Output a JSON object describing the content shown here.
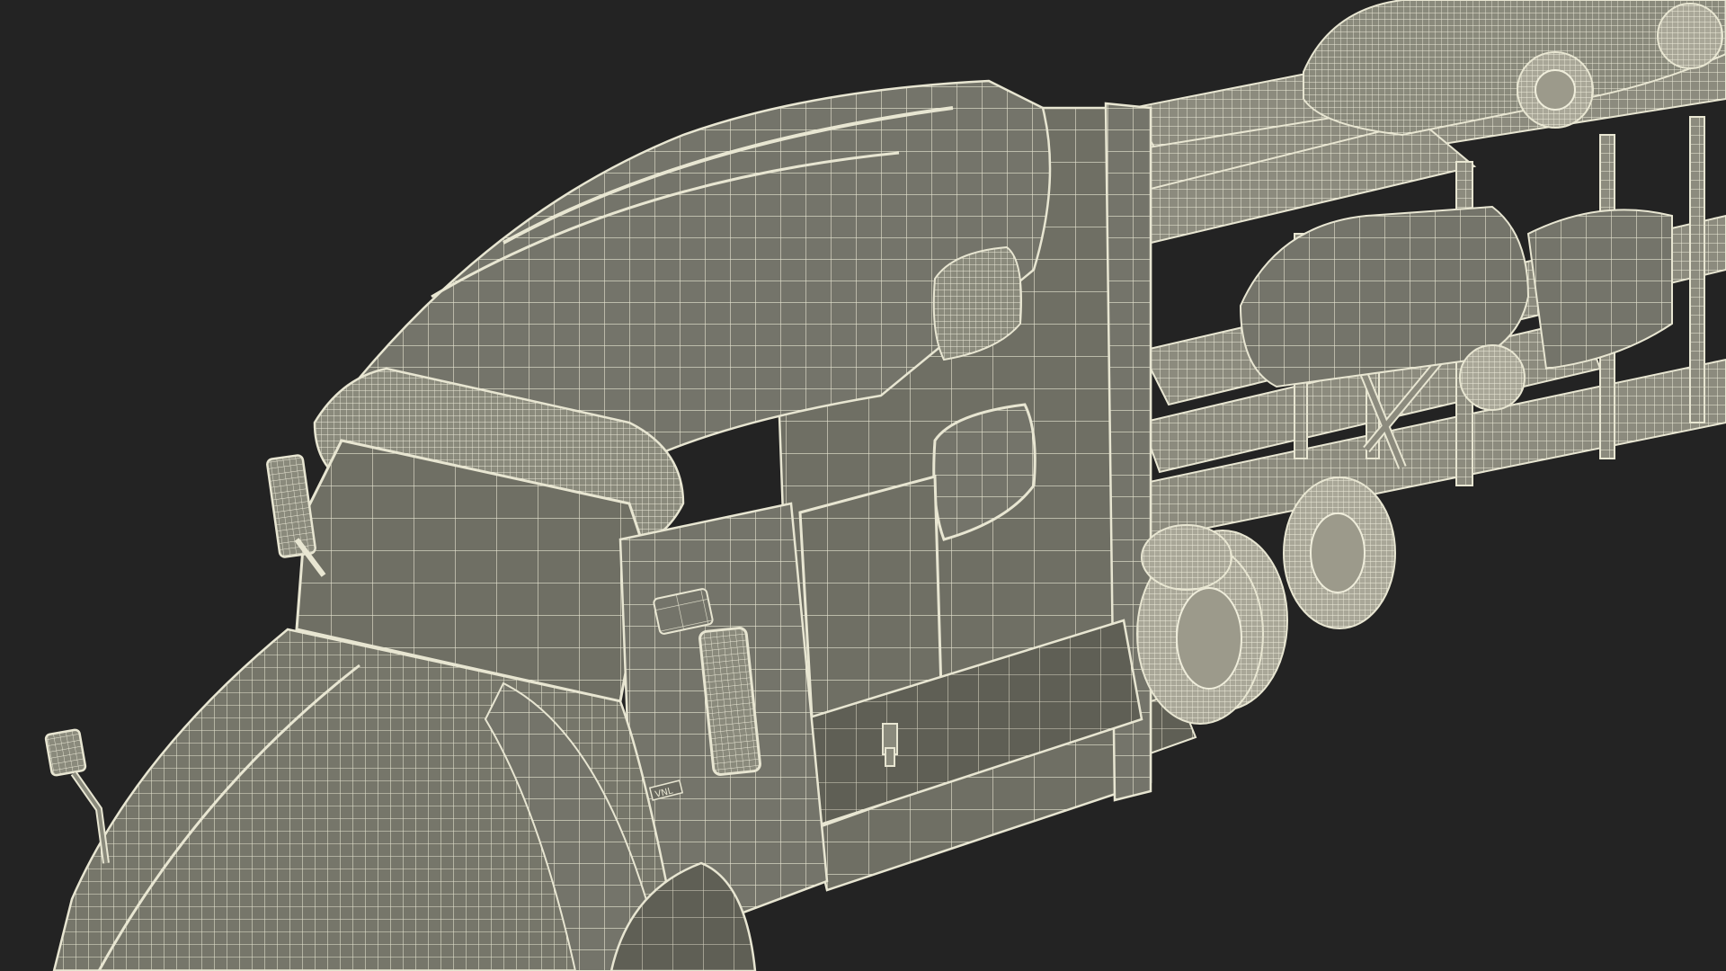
{
  "scene": {
    "subject": "semi-truck-car-carrier-wireframe",
    "render_style": "wireframe-shaded",
    "background_color": "#232323",
    "mesh_fill_color": "#76766a",
    "mesh_fill_dark": "#5f5f55",
    "mesh_fill_light": "#8a8a7c",
    "wire_color": "#e8e6d2",
    "tire_color": "#b8b6a6",
    "badge_text": "VNL"
  }
}
